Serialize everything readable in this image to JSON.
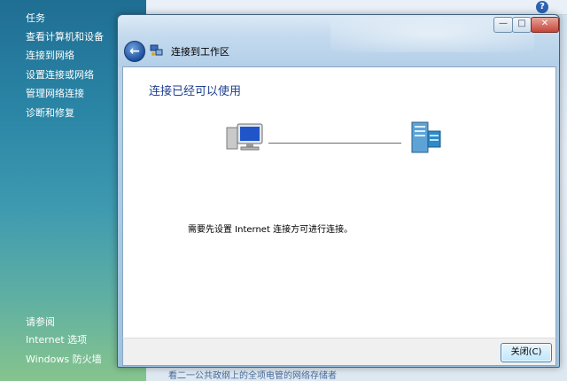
{
  "taskpane": {
    "title": "任务",
    "items": [
      {
        "label": "查看计算机和设备"
      },
      {
        "label": "连接到网络"
      },
      {
        "label": "设置连接或网络"
      },
      {
        "label": "管理网络连接"
      },
      {
        "label": "诊断和修复"
      }
    ],
    "see_also_title": "请参阅",
    "see_also": [
      {
        "label": "Internet 选项"
      },
      {
        "label": "Windows 防火墙"
      }
    ]
  },
  "background": {
    "bottom_text": "看二一公共政纲上的全项电管的网络存储者",
    "help_icon": "?"
  },
  "dialog": {
    "title": "连接到工作区",
    "heading": "连接已经可以使用",
    "message": "需要先设置 Internet 连接方可进行连接。",
    "close_button": "关闭(C)",
    "controls": {
      "min": "—",
      "max": "□",
      "close": "✕"
    },
    "back_icon": "back-arrow-icon"
  },
  "colors": {
    "heading": "#1e3f8e",
    "taskpane_top": "#1f6e93",
    "taskpane_bottom": "#86c48d"
  }
}
